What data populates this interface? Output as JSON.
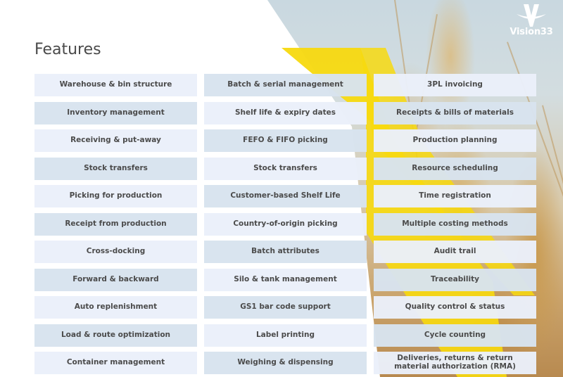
{
  "page": {
    "title": "Features"
  },
  "brand": {
    "logo_icon": "vision33-v-icon",
    "name": "Vision33",
    "accent_color": "#f7d90f",
    "text_color": "#4b4b4b",
    "row_light": "#eaf0fa",
    "row_dark": "#d8e3ee"
  },
  "columns": [
    {
      "items": [
        "Warehouse & bin structure",
        "Inventory management",
        "Receiving & put-away",
        "Stock transfers",
        "Picking for production",
        "Receipt from production",
        "Cross-docking",
        "Forward & backward",
        "Auto replenishment",
        "Load & route optimization",
        "Container management"
      ]
    },
    {
      "items": [
        "Batch & serial management",
        "Shelf life & expiry dates",
        "FEFO & FIFO picking",
        "Stock transfers",
        "Customer-based Shelf Life",
        "Country-of-origin picking",
        "Batch attributes",
        "Silo & tank management",
        "GS1 bar code support",
        "Label printing",
        "Weighing & dispensing"
      ]
    },
    {
      "items": [
        "3PL invoicing",
        "Receipts & bills of materials",
        "Production planning",
        "Resource scheduling",
        "Time registration",
        "Multiple costing methods",
        "Audit trail",
        "Traceability",
        "Quality control & status",
        "Cycle counting",
        "Deliveries, returns & return\nmaterial authorization (RMA)"
      ]
    }
  ]
}
